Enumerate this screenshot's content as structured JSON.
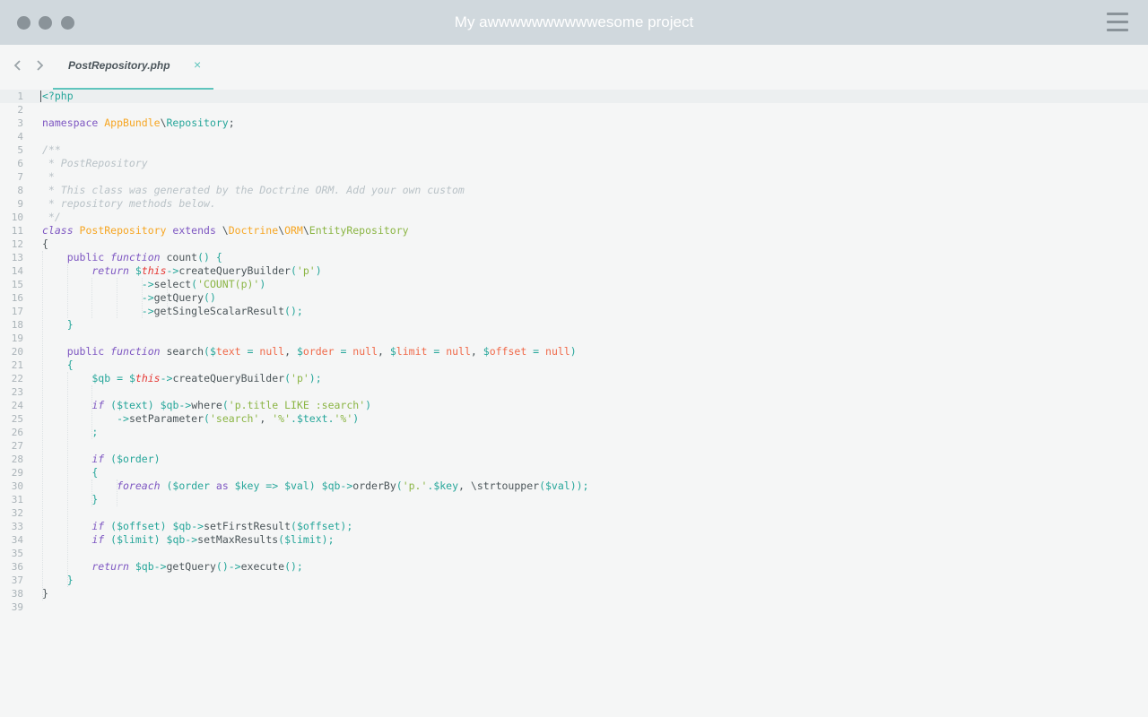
{
  "window": {
    "title": "My awwwwwwwwwwesome project"
  },
  "tabs": [
    {
      "label": "PostRepository.php",
      "close": "×"
    }
  ],
  "editor": {
    "language": "php",
    "current_line": 1,
    "lines": [
      [
        [
          "<?php",
          "op"
        ]
      ],
      [],
      [
        [
          "namespace ",
          "kw"
        ],
        [
          "AppBundle",
          "cls"
        ],
        [
          "\\",
          "fn"
        ],
        [
          "Repository",
          "ns"
        ],
        [
          ";",
          "fn"
        ]
      ],
      [],
      [
        [
          "/**",
          "cm"
        ]
      ],
      [
        [
          " * PostRepository",
          "cm"
        ]
      ],
      [
        [
          " *",
          "cm"
        ]
      ],
      [
        [
          " * This class was generated by the Doctrine ORM. Add your own custom",
          "cm"
        ]
      ],
      [
        [
          " * repository methods below.",
          "cm"
        ]
      ],
      [
        [
          " */",
          "cm"
        ]
      ],
      [
        [
          "class ",
          "kwi"
        ],
        [
          "PostRepository ",
          "cls"
        ],
        [
          "extends ",
          "kw"
        ],
        [
          "\\",
          "fn"
        ],
        [
          "Doctrine",
          "cls"
        ],
        [
          "\\",
          "fn"
        ],
        [
          "ORM",
          "cls"
        ],
        [
          "\\",
          "fn"
        ],
        [
          "EntityRepository",
          "str"
        ]
      ],
      [
        [
          "{",
          "fn"
        ]
      ],
      [
        [
          "    public ",
          "kw"
        ],
        [
          "function ",
          "kwi"
        ],
        [
          "count",
          "fn"
        ],
        [
          "() {",
          "op"
        ]
      ],
      [
        [
          "        return ",
          "kwi"
        ],
        [
          "$",
          "var"
        ],
        [
          "this",
          "thisv"
        ],
        [
          "->",
          "op"
        ],
        [
          "createQueryBuilder",
          "fn"
        ],
        [
          "(",
          "op"
        ],
        [
          "'p'",
          "str"
        ],
        [
          ")",
          "op"
        ]
      ],
      [
        [
          "                ->",
          "op"
        ],
        [
          "select",
          "fn"
        ],
        [
          "(",
          "op"
        ],
        [
          "'COUNT(p)'",
          "str"
        ],
        [
          ")",
          "op"
        ]
      ],
      [
        [
          "                ->",
          "op"
        ],
        [
          "getQuery",
          "fn"
        ],
        [
          "()",
          "op"
        ]
      ],
      [
        [
          "                ->",
          "op"
        ],
        [
          "getSingleScalarResult",
          "fn"
        ],
        [
          "();",
          "op"
        ]
      ],
      [
        [
          "    }",
          "op"
        ]
      ],
      [],
      [
        [
          "    public ",
          "kw"
        ],
        [
          "function ",
          "kwi"
        ],
        [
          "search",
          "fn"
        ],
        [
          "(",
          "op"
        ],
        [
          "$",
          "var"
        ],
        [
          "text",
          "nul"
        ],
        [
          " = ",
          "op"
        ],
        [
          "null",
          "nul"
        ],
        [
          ", ",
          "fn"
        ],
        [
          "$",
          "var"
        ],
        [
          "order",
          "nul"
        ],
        [
          " = ",
          "op"
        ],
        [
          "null",
          "nul"
        ],
        [
          ", ",
          "fn"
        ],
        [
          "$",
          "var"
        ],
        [
          "limit",
          "nul"
        ],
        [
          " = ",
          "op"
        ],
        [
          "null",
          "nul"
        ],
        [
          ", ",
          "fn"
        ],
        [
          "$",
          "var"
        ],
        [
          "offset",
          "nul"
        ],
        [
          " = ",
          "op"
        ],
        [
          "null",
          "nul"
        ],
        [
          ")",
          "op"
        ]
      ],
      [
        [
          "    {",
          "op"
        ]
      ],
      [
        [
          "        $qb ",
          "var"
        ],
        [
          "= ",
          "op"
        ],
        [
          "$",
          "var"
        ],
        [
          "this",
          "thisv"
        ],
        [
          "->",
          "op"
        ],
        [
          "createQueryBuilder",
          "fn"
        ],
        [
          "(",
          "op"
        ],
        [
          "'p'",
          "str"
        ],
        [
          ");",
          "op"
        ]
      ],
      [],
      [
        [
          "        if ",
          "kwi"
        ],
        [
          "(",
          "op"
        ],
        [
          "$text",
          "var"
        ],
        [
          ") ",
          "op"
        ],
        [
          "$qb",
          "var"
        ],
        [
          "->",
          "op"
        ],
        [
          "where",
          "fn"
        ],
        [
          "(",
          "op"
        ],
        [
          "'p.title LIKE :search'",
          "str"
        ],
        [
          ")",
          "op"
        ]
      ],
      [
        [
          "            ->",
          "op"
        ],
        [
          "setParameter",
          "fn"
        ],
        [
          "(",
          "op"
        ],
        [
          "'search'",
          "str"
        ],
        [
          ", ",
          "fn"
        ],
        [
          "'%'",
          "str"
        ],
        [
          ".",
          "op"
        ],
        [
          "$text",
          "var"
        ],
        [
          ".",
          "op"
        ],
        [
          "'%'",
          "str"
        ],
        [
          ")",
          "op"
        ]
      ],
      [
        [
          "        ;",
          "op"
        ]
      ],
      [],
      [
        [
          "        if ",
          "kwi"
        ],
        [
          "(",
          "op"
        ],
        [
          "$order",
          "var"
        ],
        [
          ")",
          "op"
        ]
      ],
      [
        [
          "        {",
          "op"
        ]
      ],
      [
        [
          "            foreach ",
          "kwi"
        ],
        [
          "(",
          "op"
        ],
        [
          "$order ",
          "var"
        ],
        [
          "as ",
          "kw"
        ],
        [
          "$key ",
          "var"
        ],
        [
          "=> ",
          "op"
        ],
        [
          "$val",
          "var"
        ],
        [
          ") ",
          "op"
        ],
        [
          "$qb",
          "var"
        ],
        [
          "->",
          "op"
        ],
        [
          "orderBy",
          "fn"
        ],
        [
          "(",
          "op"
        ],
        [
          "'p.'",
          "str"
        ],
        [
          ".",
          "op"
        ],
        [
          "$key",
          "var"
        ],
        [
          ", ",
          "fn"
        ],
        [
          "\\strtoupper",
          "fn"
        ],
        [
          "(",
          "op"
        ],
        [
          "$val",
          "var"
        ],
        [
          "));",
          "op"
        ]
      ],
      [
        [
          "        }",
          "op"
        ]
      ],
      [],
      [
        [
          "        if ",
          "kwi"
        ],
        [
          "(",
          "op"
        ],
        [
          "$offset",
          "var"
        ],
        [
          ") ",
          "op"
        ],
        [
          "$qb",
          "var"
        ],
        [
          "->",
          "op"
        ],
        [
          "setFirstResult",
          "fn"
        ],
        [
          "(",
          "op"
        ],
        [
          "$offset",
          "var"
        ],
        [
          ");",
          "op"
        ]
      ],
      [
        [
          "        if ",
          "kwi"
        ],
        [
          "(",
          "op"
        ],
        [
          "$limit",
          "var"
        ],
        [
          ") ",
          "op"
        ],
        [
          "$qb",
          "var"
        ],
        [
          "->",
          "op"
        ],
        [
          "setMaxResults",
          "fn"
        ],
        [
          "(",
          "op"
        ],
        [
          "$limit",
          "var"
        ],
        [
          ");",
          "op"
        ]
      ],
      [],
      [
        [
          "        return ",
          "kwi"
        ],
        [
          "$qb",
          "var"
        ],
        [
          "->",
          "op"
        ],
        [
          "getQuery",
          "fn"
        ],
        [
          "()->",
          "op"
        ],
        [
          "execute",
          "fn"
        ],
        [
          "();",
          "op"
        ]
      ],
      [
        [
          "    }",
          "op"
        ]
      ],
      [
        [
          "}",
          "fn"
        ]
      ],
      []
    ]
  }
}
